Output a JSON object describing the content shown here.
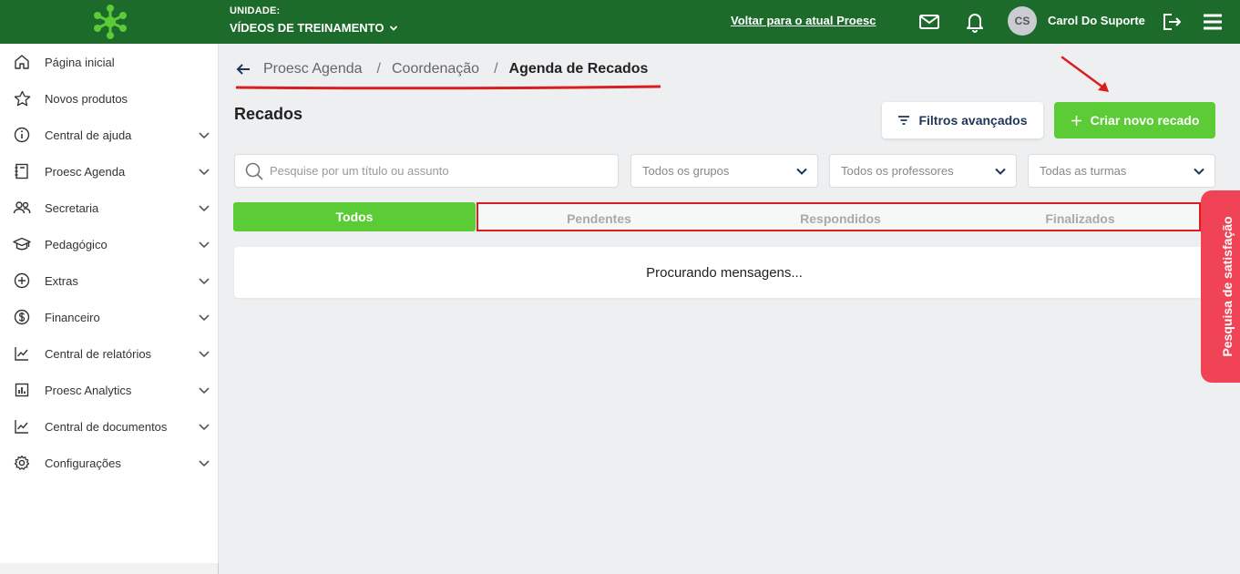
{
  "topbar": {
    "unit_label": "UNIDADE:",
    "unit_name": "VÍDEOS DE TREINAMENTO",
    "back_link": "Voltar para o atual Proesc",
    "avatar_initials": "CS",
    "user_name": "Carol Do Suporte"
  },
  "sidebar": {
    "items": [
      {
        "label": "Página inicial",
        "icon": "home-icon",
        "expandable": false
      },
      {
        "label": "Novos produtos",
        "icon": "star-icon",
        "expandable": false
      },
      {
        "label": "Central de ajuda",
        "icon": "info-icon",
        "expandable": true
      },
      {
        "label": "Proesc Agenda",
        "icon": "agenda-icon",
        "expandable": true
      },
      {
        "label": "Secretaria",
        "icon": "users-icon",
        "expandable": true
      },
      {
        "label": "Pedagógico",
        "icon": "graduation-cap-icon",
        "expandable": true
      },
      {
        "label": "Extras",
        "icon": "plus-circle-icon",
        "expandable": true
      },
      {
        "label": "Financeiro",
        "icon": "dollar-icon",
        "expandable": true
      },
      {
        "label": "Central de relatórios",
        "icon": "line-chart-icon",
        "expandable": true
      },
      {
        "label": "Proesc Analytics",
        "icon": "bar-chart-icon",
        "expandable": true
      },
      {
        "label": "Central de documentos",
        "icon": "trend-chart-icon",
        "expandable": true
      },
      {
        "label": "Configurações",
        "icon": "gear-icon",
        "expandable": true
      }
    ]
  },
  "breadcrumb": {
    "items": [
      "Proesc Agenda",
      "Coordenação"
    ],
    "current": "Agenda de Recados"
  },
  "page": {
    "title": "Recados",
    "filters_button": "Filtros avançados",
    "create_button": "Criar novo recado"
  },
  "filters": {
    "search_placeholder": "Pesquise por um título ou assunto",
    "groups": "Todos os grupos",
    "teachers": "Todos os professores",
    "classes": "Todas as turmas"
  },
  "tabs": {
    "all": "Todos",
    "pending": "Pendentes",
    "answered": "Respondidos",
    "finished": "Finalizados"
  },
  "results": {
    "status": "Procurando mensagens..."
  },
  "survey": {
    "label": "Pesquisa de satisfação"
  },
  "colors": {
    "topbar": "#1c6b2b",
    "accent_green": "#5ccc36",
    "annotation_red": "#d81e1e",
    "survey_red": "#f04355"
  }
}
